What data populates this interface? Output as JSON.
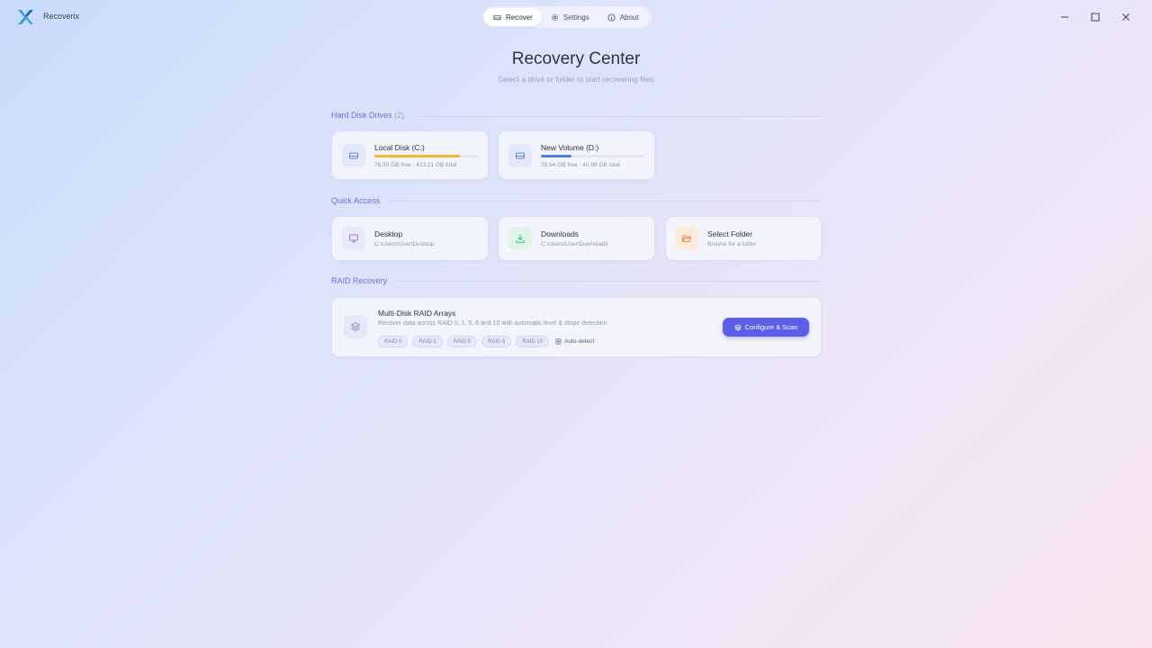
{
  "app": {
    "name": "Recoverix"
  },
  "nav": {
    "items": [
      {
        "label": "Recover",
        "icon": "drive-icon",
        "active": true
      },
      {
        "label": "Settings",
        "icon": "gear-icon",
        "active": false
      },
      {
        "label": "About",
        "icon": "info-icon",
        "active": false
      }
    ]
  },
  "header": {
    "title": "Recovery Center",
    "subtitle": "Select a drive or folder to start recovering files"
  },
  "drives_section": {
    "title": "Hard Disk Drives",
    "count": "(2)",
    "drives": [
      {
        "name": "Local Disk (C:)",
        "detail": "76.50 GB free · 423.21 GB total",
        "used_fraction": 0.82,
        "bar_color": "#f5b82e"
      },
      {
        "name": "New Volume (D:)",
        "detail": "28.94 GB free · 40.98 GB total",
        "used_fraction": 0.29,
        "bar_color": "#4a7fe8"
      }
    ]
  },
  "quick_section": {
    "title": "Quick Access",
    "items": [
      {
        "name": "Desktop",
        "detail": "C:\\Users\\User\\Desktop",
        "icon": "monitor-icon",
        "color": "#8b7fd6"
      },
      {
        "name": "Downloads",
        "detail": "C:\\Users\\User\\Downloads",
        "icon": "download-icon",
        "color": "#3fb87f"
      },
      {
        "name": "Select Folder",
        "detail": "Browse for a folder",
        "icon": "folder-open-icon",
        "color": "#f08a3c"
      }
    ]
  },
  "raid_section": {
    "title": "RAID Recovery",
    "card_title": "Multi-Disk RAID Arrays",
    "card_desc": "Recover data across RAID 0, 1, 5, 6 and 10 with automatic level & stripe detection",
    "chips": [
      "RAID 0",
      "RAID 1",
      "RAID 5",
      "RAID 6",
      "RAID 10"
    ],
    "auto_detect": "Auto-detect",
    "button_label": "Configure & Scan"
  },
  "colors": {
    "accent": "#5b5ee8",
    "section_title": "#6672d6"
  }
}
